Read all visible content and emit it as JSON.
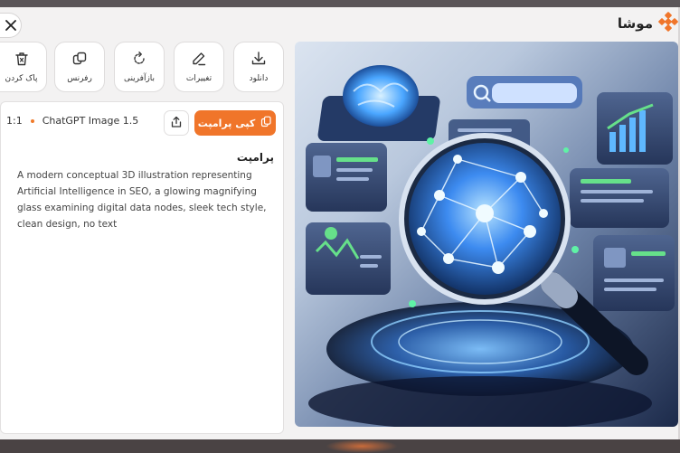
{
  "brand": {
    "name": "موشا",
    "icon": "brand-logo-icon"
  },
  "close": {
    "icon": "close-icon"
  },
  "toolbar": {
    "buttons": [
      {
        "label": "دانلود",
        "icon": "download-icon"
      },
      {
        "label": "تغییرات",
        "icon": "edit-icon"
      },
      {
        "label": "بازآفرینی",
        "icon": "regenerate-icon"
      },
      {
        "label": "رفرنس",
        "icon": "reference-icon"
      },
      {
        "label": "پاک کردن",
        "icon": "trash-icon"
      }
    ]
  },
  "details": {
    "ratio": "1:1",
    "model": "ChatGPT Image 1.5",
    "copy_label": "کپی پرامپت",
    "share_icon": "share-icon"
  },
  "prompt": {
    "heading": "پرامپت",
    "text": "A modern conceptual 3D illustration representing Artificial Intelligence in SEO, a glowing magnifying glass examining digital data nodes, sleek tech style, clean design, no text"
  },
  "colors": {
    "accent": "#f0752a",
    "modal_bg": "#f3f2f2",
    "glow": "#4da3ff"
  }
}
